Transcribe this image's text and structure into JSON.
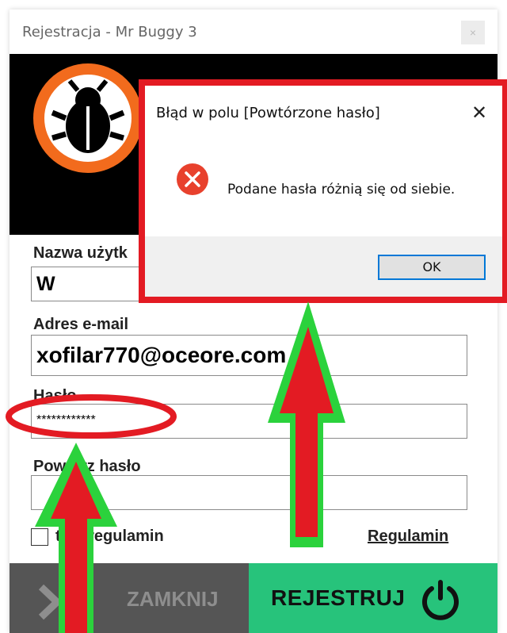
{
  "window": {
    "title": "Rejestracja - Mr Buggy 3",
    "close_glyph": "×"
  },
  "form": {
    "username_label": "Nazwa użytk",
    "username_value": "W",
    "email_label": "Adres e-mail",
    "email_value": "xofilar770@oceore.com",
    "password_label": "Hasło",
    "password_value": "************",
    "repeat_label": "Powtórz hasło",
    "repeat_value": "",
    "accept_label": "tuję regulamin",
    "terms_link": "Regulamin"
  },
  "footer": {
    "close_label": "ZAMKNIJ",
    "register_label": "REJESTRUJ"
  },
  "dialog": {
    "title": "Błąd w polu [Powtórzone hasło]",
    "close_glyph": "✕",
    "message": "Podane hasła różnią się od siebie.",
    "ok_label": "OK"
  },
  "icons": {
    "logo": "bug-logo-icon",
    "error": "error-icon",
    "power": "power-icon",
    "chevron": "chevron-right-icon"
  },
  "colors": {
    "accent_orange": "#f26b1d",
    "register_green": "#27c37b",
    "annotation_red": "#e31b23",
    "annotation_green": "#2bd23c",
    "footer_gray": "#555555"
  }
}
